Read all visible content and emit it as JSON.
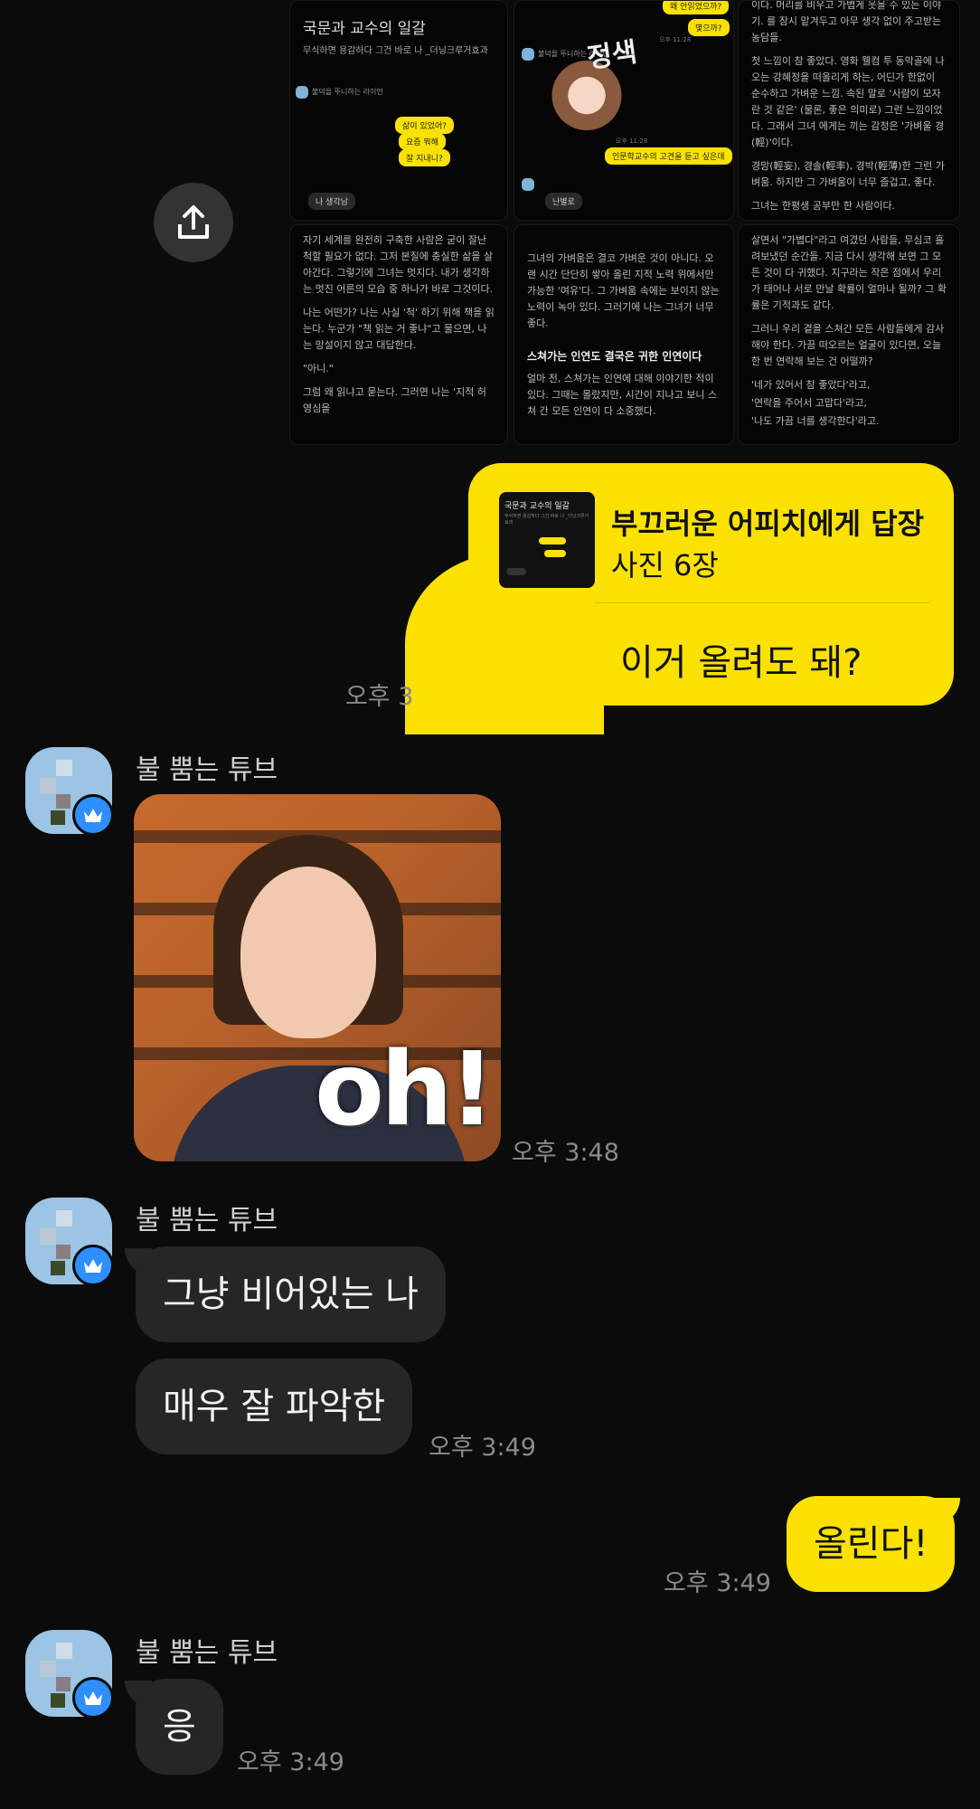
{
  "shared_photos": {
    "tile1": {
      "title": "국문과 교수의 일갈",
      "subtitle": "무식하면 용감하다 그건 바로 나 _더닝크루거효과",
      "mini_name1": "불덕을 뚜니하는 라이언",
      "mini_reply1": "삶이 있었어?",
      "mini_reply2": "요즘 뭐해",
      "mini_reply3": "잘 지내니?",
      "mini_dark1": "나 생각남"
    },
    "tile2": {
      "bubble_top1": "왜 안읽었으까?",
      "bubble_top2": "몇으까?",
      "mini_name": "불덕을 뚜니하는 라이언",
      "sticker_text": "정색",
      "bubble_mine": "인문학교수의 고견을 듣고 싶은데",
      "dark_reply": "난별로",
      "time1": "오후 11:28",
      "time2": "오후 11:28"
    },
    "tile3": {
      "p1": "이다. 머리를 비우고 가볍게 웃을 수 있는 이야기. 를 잠시 맡겨두고 아무 생각 없이 주고받는 농담들.",
      "p2": "첫 느낌이 참 좋았다. 영화 웰컴 투 동막골에 나오는 강혜정을 떠올리게 하는, 어딘가 한없이 순수하고 가벼운 느낌. 속된 말로 '사람이 모자란 것 같은' (물론, 좋은 의미로) 그런 느낌이었다. 그래서 그녀 에게는 끼는 감정은 '가벼울 경(輕)'이다.",
      "p3": "경망(輕妄), 경솔(輕率), 경박(輕薄)한 그런 가벼움. 하지만 그 가벼움이 너무 즐겁고, 좋다.",
      "p4": "그녀는 한평생 공부만 한 사람이다."
    },
    "tile4": {
      "p1": "자기 세계를 완전히 구축한 사람은 굳이 잘난 척할 필요가 없다. 그저 본질에 충실한 삶을 살아간다. 그렇기에 그녀는 멋지다. 내가 생각하는 멋진 어른의 모습 중 하나가 바로 그것이다.",
      "p2": "나는 어떤가? 나는 사실 '척' 하기 위해 책을 읽는다. 누군가 \"책 읽는 거 좋냐\"고 물으면, 나는 망설이지 않고 대답한다.",
      "p3": "\"아니.\"",
      "p4": "그럼 왜 읽냐고 묻는다. 그러면 나는 '지적 허영심을"
    },
    "tile5": {
      "p1": "그녀의 가벼움은 결코 가벼운 것이 아니다. 오랜 시간 단단히 쌓아 올린 지적 노력 위에서만 가능한 '여유'다. 그 가벼움 속에는 보이지 않는 노력이 녹아 있다. 그러기에 나는 그녀가 너무 좋다.",
      "heading": "스쳐가는 인연도 결국은 귀한 인연이다",
      "p2": "얼마 전, 스쳐가는 인연에 대해 이야기한 적이 있다. 그때는 몰랐지만, 시간이 지나고 보니 스쳐 간 모든 인연이 다 소중했다."
    },
    "tile6": {
      "p1": "살면서 \"가볍다\"라고 여겼던 사람들, 무심코 흘려보냈던 순간들. 지금 다시 생각해 보면 그 모든 것이 다 귀했다. 지구라는 작은 점에서 우리가 태어나 서로 만날 확률이 얼마나 될까? 그 확률은 기적과도 같다.",
      "p2": "그러니 우리 곁을 스쳐간 모든 사람들에게 감사해야 한다. 가끔 떠오르는 얼굴이 있다면, 오늘 한 번 연락해 보는 건 어떨까?",
      "p3": "'네가 있어서 참 좋았다'라고,",
      "p4": "'연락을 주어서 고맙다'라고,",
      "p5": "'나도 가끔 너를 생각한다'라고."
    }
  },
  "share_icon": "share-upload-icon",
  "reply_message": {
    "thumb_title": "국문과 교수의 일갈",
    "thumb_sub": "무식하면 용감하다 그건 바로 나 _더닝크루거효과",
    "reply_to": "부끄러운 어피치에게 답장",
    "photo_count": "사진 6장",
    "text": "이거 올려도 돼?",
    "time": "오후 3"
  },
  "messages": [
    {
      "sender": "불 뿜는 튜브",
      "type": "sticker",
      "sticker_text": "oh!",
      "time": "오후 3:48"
    },
    {
      "sender": "불 뿜는 튜브",
      "texts": [
        "그냥 비어있는 나",
        "매우 잘 파악한"
      ],
      "time": "오후 3:49"
    },
    {
      "sender": "me",
      "text": "올린다!",
      "time": "오후 3:49"
    },
    {
      "sender": "불 뿜는 튜브",
      "texts": [
        "응"
      ],
      "time": "오후 3:49"
    }
  ],
  "colors": {
    "my_bubble": "#fae100",
    "other_bubble": "#262626",
    "background": "#0b0b0b",
    "crown_badge": "#2f8fff"
  }
}
